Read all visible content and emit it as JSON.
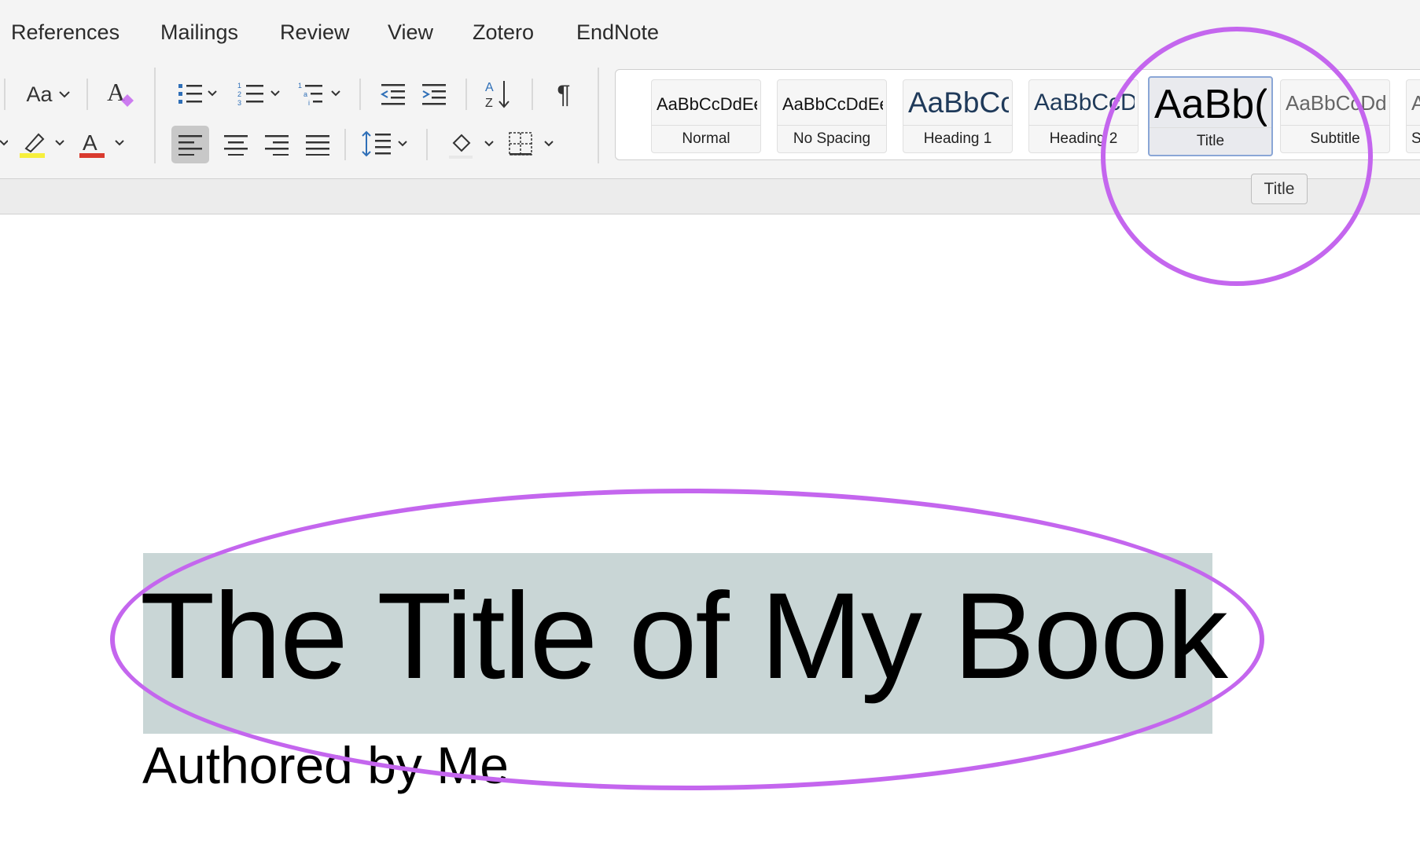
{
  "menu": {
    "tabs": [
      "References",
      "Mailings",
      "Review",
      "View",
      "Zotero",
      "EndNote"
    ]
  },
  "toolbar": {
    "font_case_label": "Aa",
    "sort_label_a": "A",
    "sort_label_z": "Z",
    "pilcrow": "¶",
    "font_color_letter": "A",
    "highlight_color": "#f6ef3c",
    "font_color": "#d93a2e"
  },
  "styles": {
    "items": [
      {
        "sample": "AaBbCcDdEe",
        "label": "Normal"
      },
      {
        "sample": "AaBbCcDdEe",
        "label": "No Spacing"
      },
      {
        "sample": "AaBbCc",
        "label": "Heading 1"
      },
      {
        "sample": "AaBbCcDd",
        "label": "Heading 2"
      },
      {
        "sample": "AaBb(",
        "label": "Title"
      },
      {
        "sample": "AaBbCcDd",
        "label": "Subtitle"
      },
      {
        "sample": "A",
        "label": "S"
      }
    ],
    "selected": "Title",
    "tooltip": "Title"
  },
  "document": {
    "title": "The Title of My Book",
    "subtitle": "Authored by Me"
  },
  "colors": {
    "annotation": "#c466ee",
    "selection_highlight": "#c9d6d6",
    "heading_blue": "#1f3a5a"
  }
}
